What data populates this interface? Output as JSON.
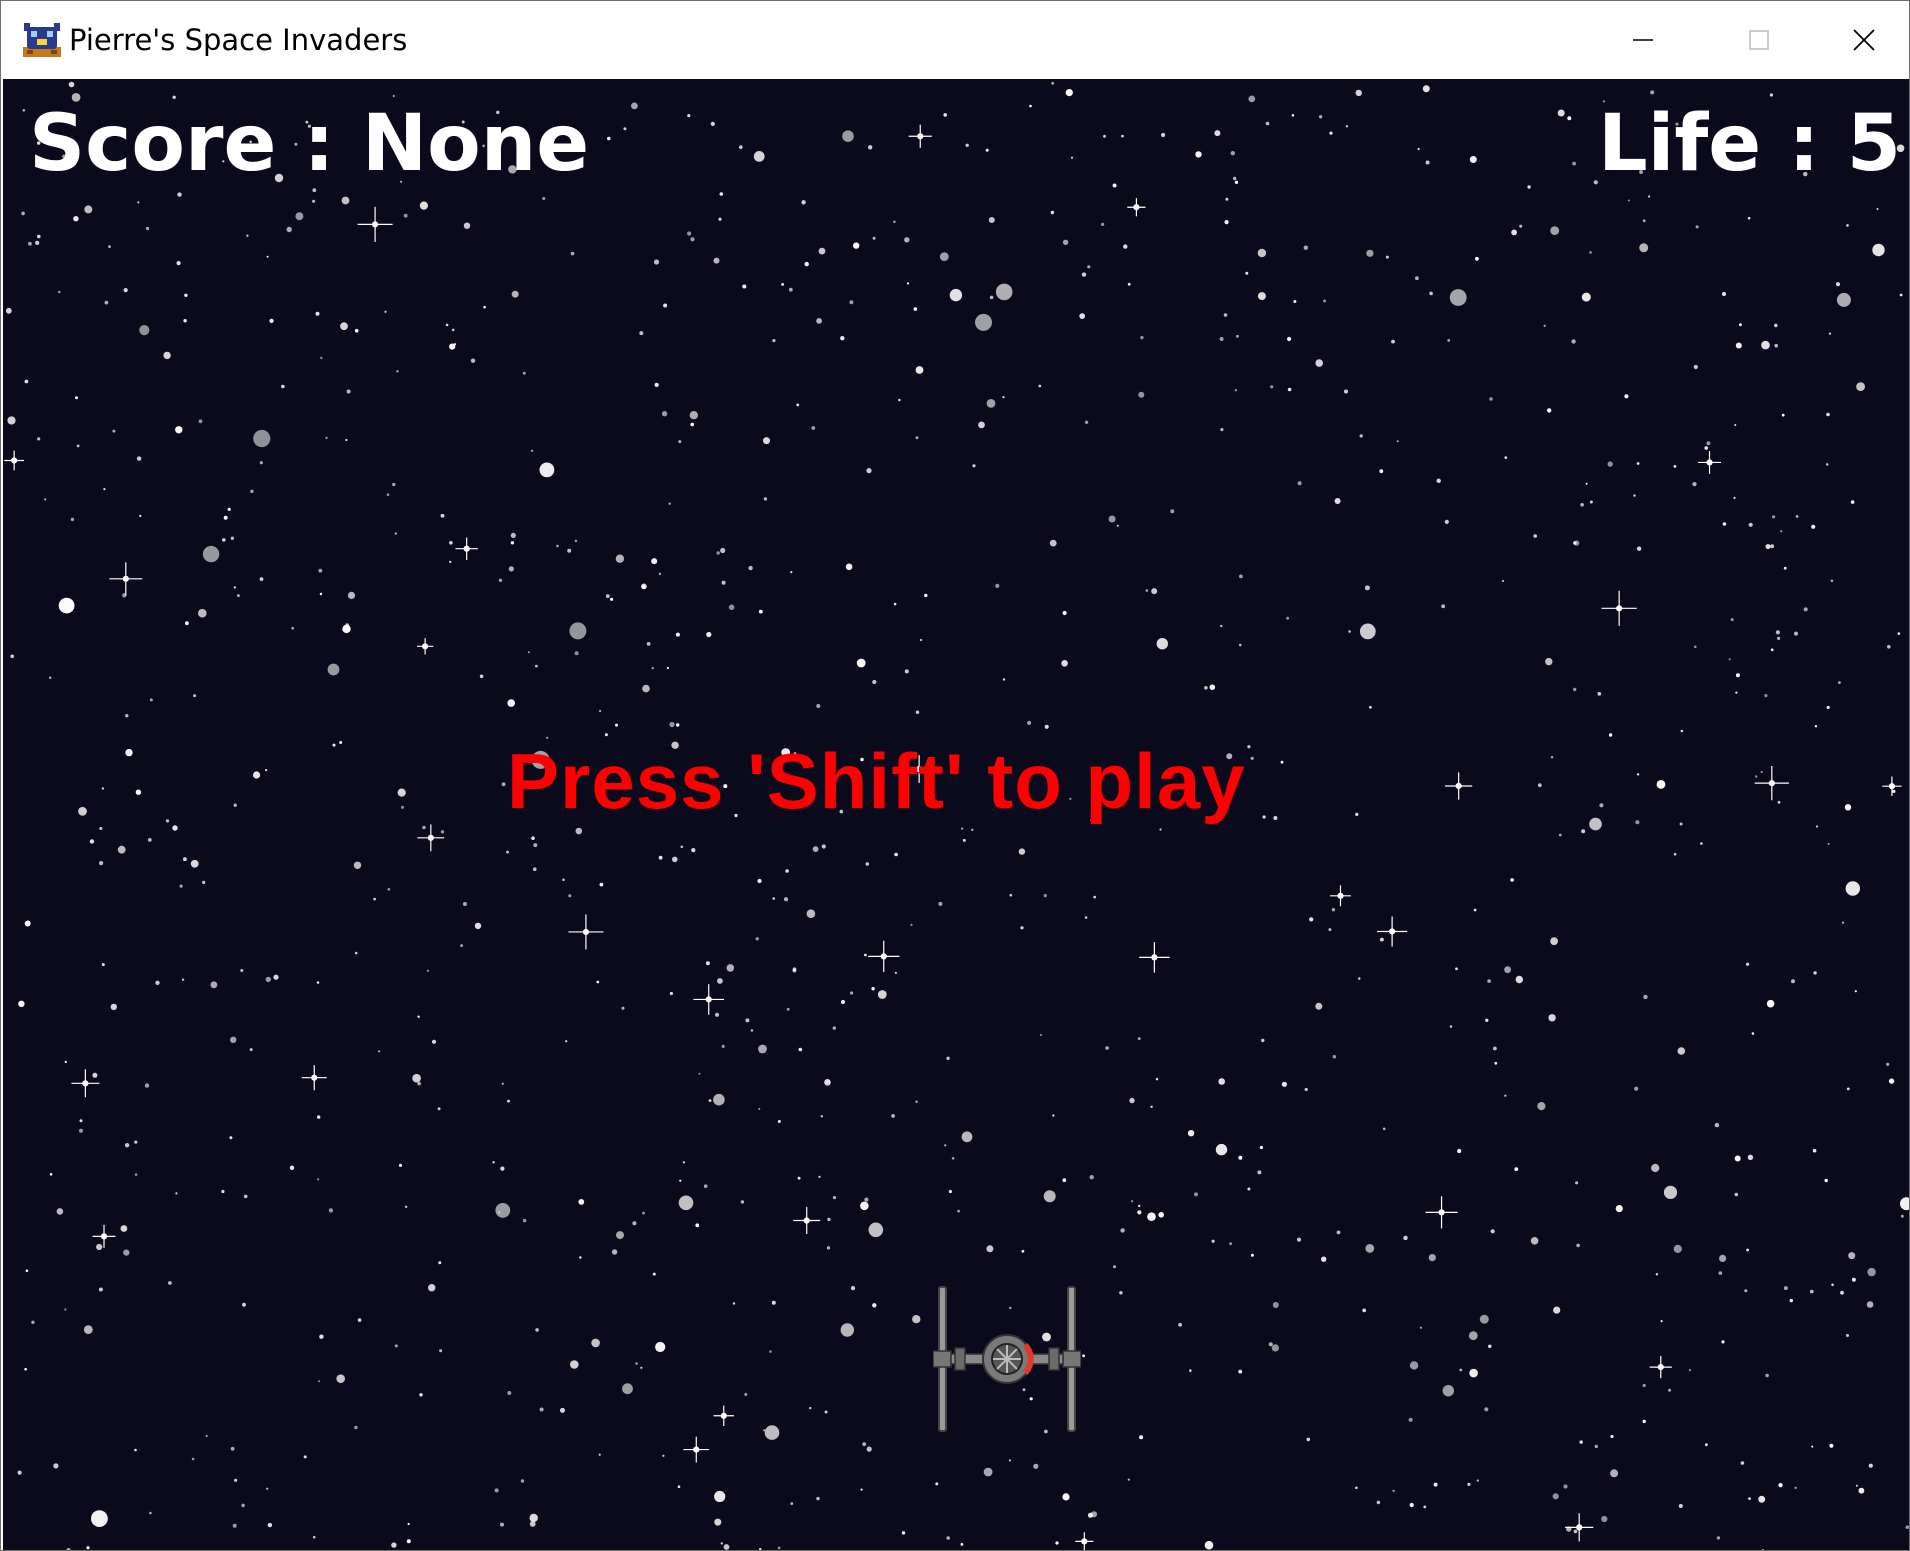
{
  "window": {
    "title": "Pierre's Space Invaders",
    "icon": "space-invaders-app-icon"
  },
  "hud": {
    "score_text": "Score : None",
    "life_text": "Life : 5"
  },
  "prompt": {
    "text": "Press 'Shift' to play",
    "color": "#ff0000"
  },
  "player": {
    "icon": "tie-fighter-ship"
  },
  "colors": {
    "background": "#0a0a1c",
    "hud_text": "#ffffff"
  }
}
